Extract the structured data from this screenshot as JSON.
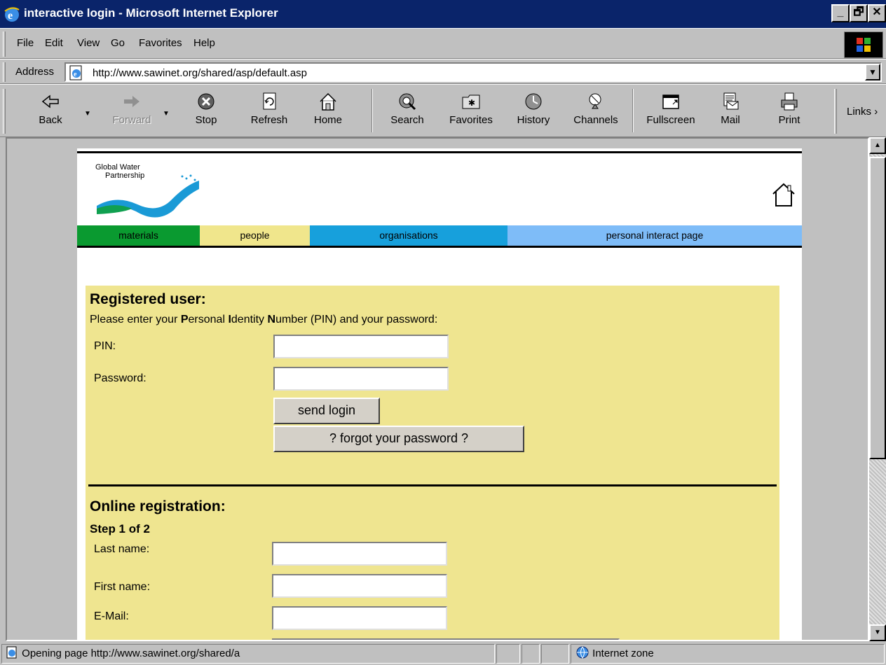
{
  "window": {
    "title": "interactive login - Microsoft Internet Explorer",
    "controls": [
      "_",
      "🗗",
      "✕"
    ]
  },
  "menu": [
    "File",
    "Edit",
    "View",
    "Go",
    "Favorites",
    "Help"
  ],
  "address": {
    "label": "Address",
    "url": "http://www.sawinet.org/shared/asp/default.asp"
  },
  "toolbar": {
    "buttons": [
      "Back",
      "Forward",
      "Stop",
      "Refresh",
      "Home",
      "Search",
      "Favorites",
      "History",
      "Channels",
      "Fullscreen",
      "Mail",
      "Print"
    ],
    "links_label": "Links"
  },
  "page": {
    "logo_text_1": "Global Water",
    "logo_text_2": "Partnership",
    "nav": [
      "materials",
      "people",
      "organisations",
      "personal interact page"
    ],
    "registered": {
      "heading": "Registered user:",
      "instr_1": "Please enter your ",
      "instr_p": "P",
      "instr_2": "ersonal ",
      "instr_i": "I",
      "instr_3": "dentity ",
      "instr_n": "N",
      "instr_4": "umber (PIN) and your password:",
      "pin_label": "PIN:",
      "password_label": "Password:",
      "send_button": "send login",
      "forgot_button": "? forgot your password ?"
    },
    "registration": {
      "heading": "Online registration:",
      "step": "Step 1 of 2",
      "last_name_label": "Last name:",
      "first_name_label": "First name:",
      "email_label": "E-Mail:"
    }
  },
  "status": {
    "message": "Opening page http://www.sawinet.org/shared/a",
    "zone": "Internet zone"
  },
  "colors": {
    "titlebar": "#0a246a",
    "nav_materials": "#0a9a30",
    "nav_people": "#f0e68c",
    "nav_organisations": "#17a0dc",
    "nav_personal": "#7ebcf8",
    "panel": "#efe590"
  }
}
